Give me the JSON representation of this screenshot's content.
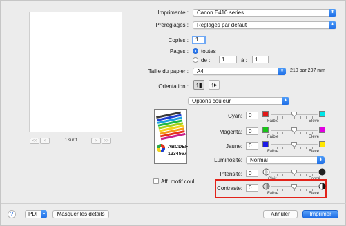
{
  "printer": {
    "label": "Imprimante :",
    "value": "Canon E410 series"
  },
  "presets": {
    "label": "Préréglages :",
    "value": "Réglages par défaut"
  },
  "copies": {
    "label": "Copies :",
    "value": "1"
  },
  "pages": {
    "label": "Pages :",
    "all_label": "toutes",
    "from_label": "de :",
    "from_value": "1",
    "to_label": "à :",
    "to_value": "1"
  },
  "paper_size": {
    "label": "Taille du papier :",
    "value": "A4",
    "dimensions": "210 par 297 mm"
  },
  "orientation": {
    "label": "Orientation :"
  },
  "section_popup": {
    "value": "Options couleur"
  },
  "preview_nav": {
    "first": "<<",
    "prev": "<",
    "page_text": "1 sur 1",
    "next": ">",
    "last": ">>"
  },
  "preview_image": {
    "text_line1": "ABCDEF",
    "text_line2": "1234567"
  },
  "cyan": {
    "label": "Cyan:",
    "value": "0",
    "min_label": "Faible",
    "max_label": "Elevé",
    "level": 0.5
  },
  "magenta": {
    "label": "Magenta:",
    "value": "0",
    "min_label": "Faible",
    "max_label": "Elevé",
    "level": 0.5
  },
  "yellow": {
    "label": "Jaune:",
    "value": "0",
    "min_label": "Faible",
    "max_label": "Elevé",
    "level": 0.5
  },
  "brightness": {
    "label": "Luminosité:",
    "value": "Normal"
  },
  "intensity": {
    "label": "Intensité:",
    "value": "0",
    "min_label": "Clair",
    "max_label": "Foncé",
    "level": 0.5
  },
  "contrast": {
    "label": "Contraste:",
    "value": "0",
    "min_label": "Faible",
    "max_label": "Elevé",
    "level": 0.5
  },
  "show_pattern": {
    "label": "Aff. motif coul."
  },
  "footer": {
    "help": "?",
    "pdf_label": "PDF",
    "details_label": "Masquer les détails",
    "cancel_label": "Annuler",
    "print_label": "Imprimer"
  },
  "colors": {
    "accent": "#1e6ee6",
    "cyan_swatch": "#00e5e8",
    "magenta_swatch": "#e000e0",
    "yellow_swatch": "#ffe600",
    "red_swatch": "#e21818",
    "green_swatch": "#19c419",
    "blue_swatch": "#1a1ae6",
    "highlight_frame": "#e2231a"
  }
}
